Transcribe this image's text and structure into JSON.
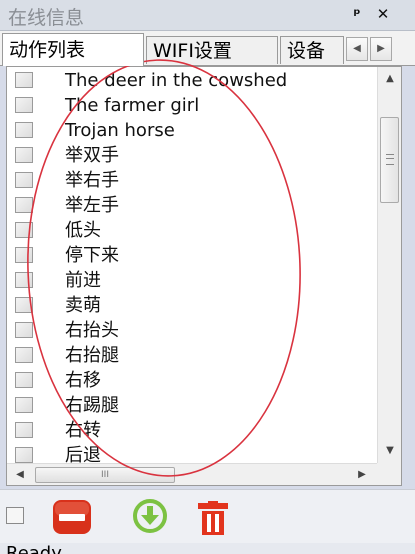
{
  "window": {
    "title": "在线信息",
    "pin_label": "ᵖ",
    "close_label": "✕"
  },
  "tabs": [
    {
      "label": "动作列表",
      "active": true
    },
    {
      "label": "WIFI设置",
      "active": false
    },
    {
      "label": "设备",
      "active": false
    }
  ],
  "tab_scroll": {
    "left": "◀",
    "right": "▶"
  },
  "actions": [
    {
      "label": "The deer in the cowshed",
      "checked": false
    },
    {
      "label": "The farmer girl",
      "checked": false
    },
    {
      "label": "Trojan horse",
      "checked": false
    },
    {
      "label": "举双手",
      "checked": false
    },
    {
      "label": "举右手",
      "checked": false
    },
    {
      "label": "举左手",
      "checked": false
    },
    {
      "label": "低头",
      "checked": false
    },
    {
      "label": "停下来",
      "checked": false
    },
    {
      "label": "前进",
      "checked": false
    },
    {
      "label": "卖萌",
      "checked": false
    },
    {
      "label": "右抬头",
      "checked": false
    },
    {
      "label": "右抬腿",
      "checked": false
    },
    {
      "label": "右移",
      "checked": false
    },
    {
      "label": "右踢腿",
      "checked": false
    },
    {
      "label": "右转",
      "checked": false
    },
    {
      "label": "后退",
      "checked": false
    }
  ],
  "scrollbar": {
    "up": "▲",
    "down": "▼",
    "left": "◀",
    "right": "▶",
    "h_grip": "III"
  },
  "toolbar": {
    "select_all_checked": false,
    "icons": [
      "delete-icon",
      "download-icon",
      "trash-icon"
    ]
  },
  "status": {
    "text": "Ready"
  },
  "colors": {
    "annotation": "#d9333f",
    "delete_red": "#d8311b",
    "download_green": "#7cc242",
    "trash_red": "#e2341d"
  }
}
